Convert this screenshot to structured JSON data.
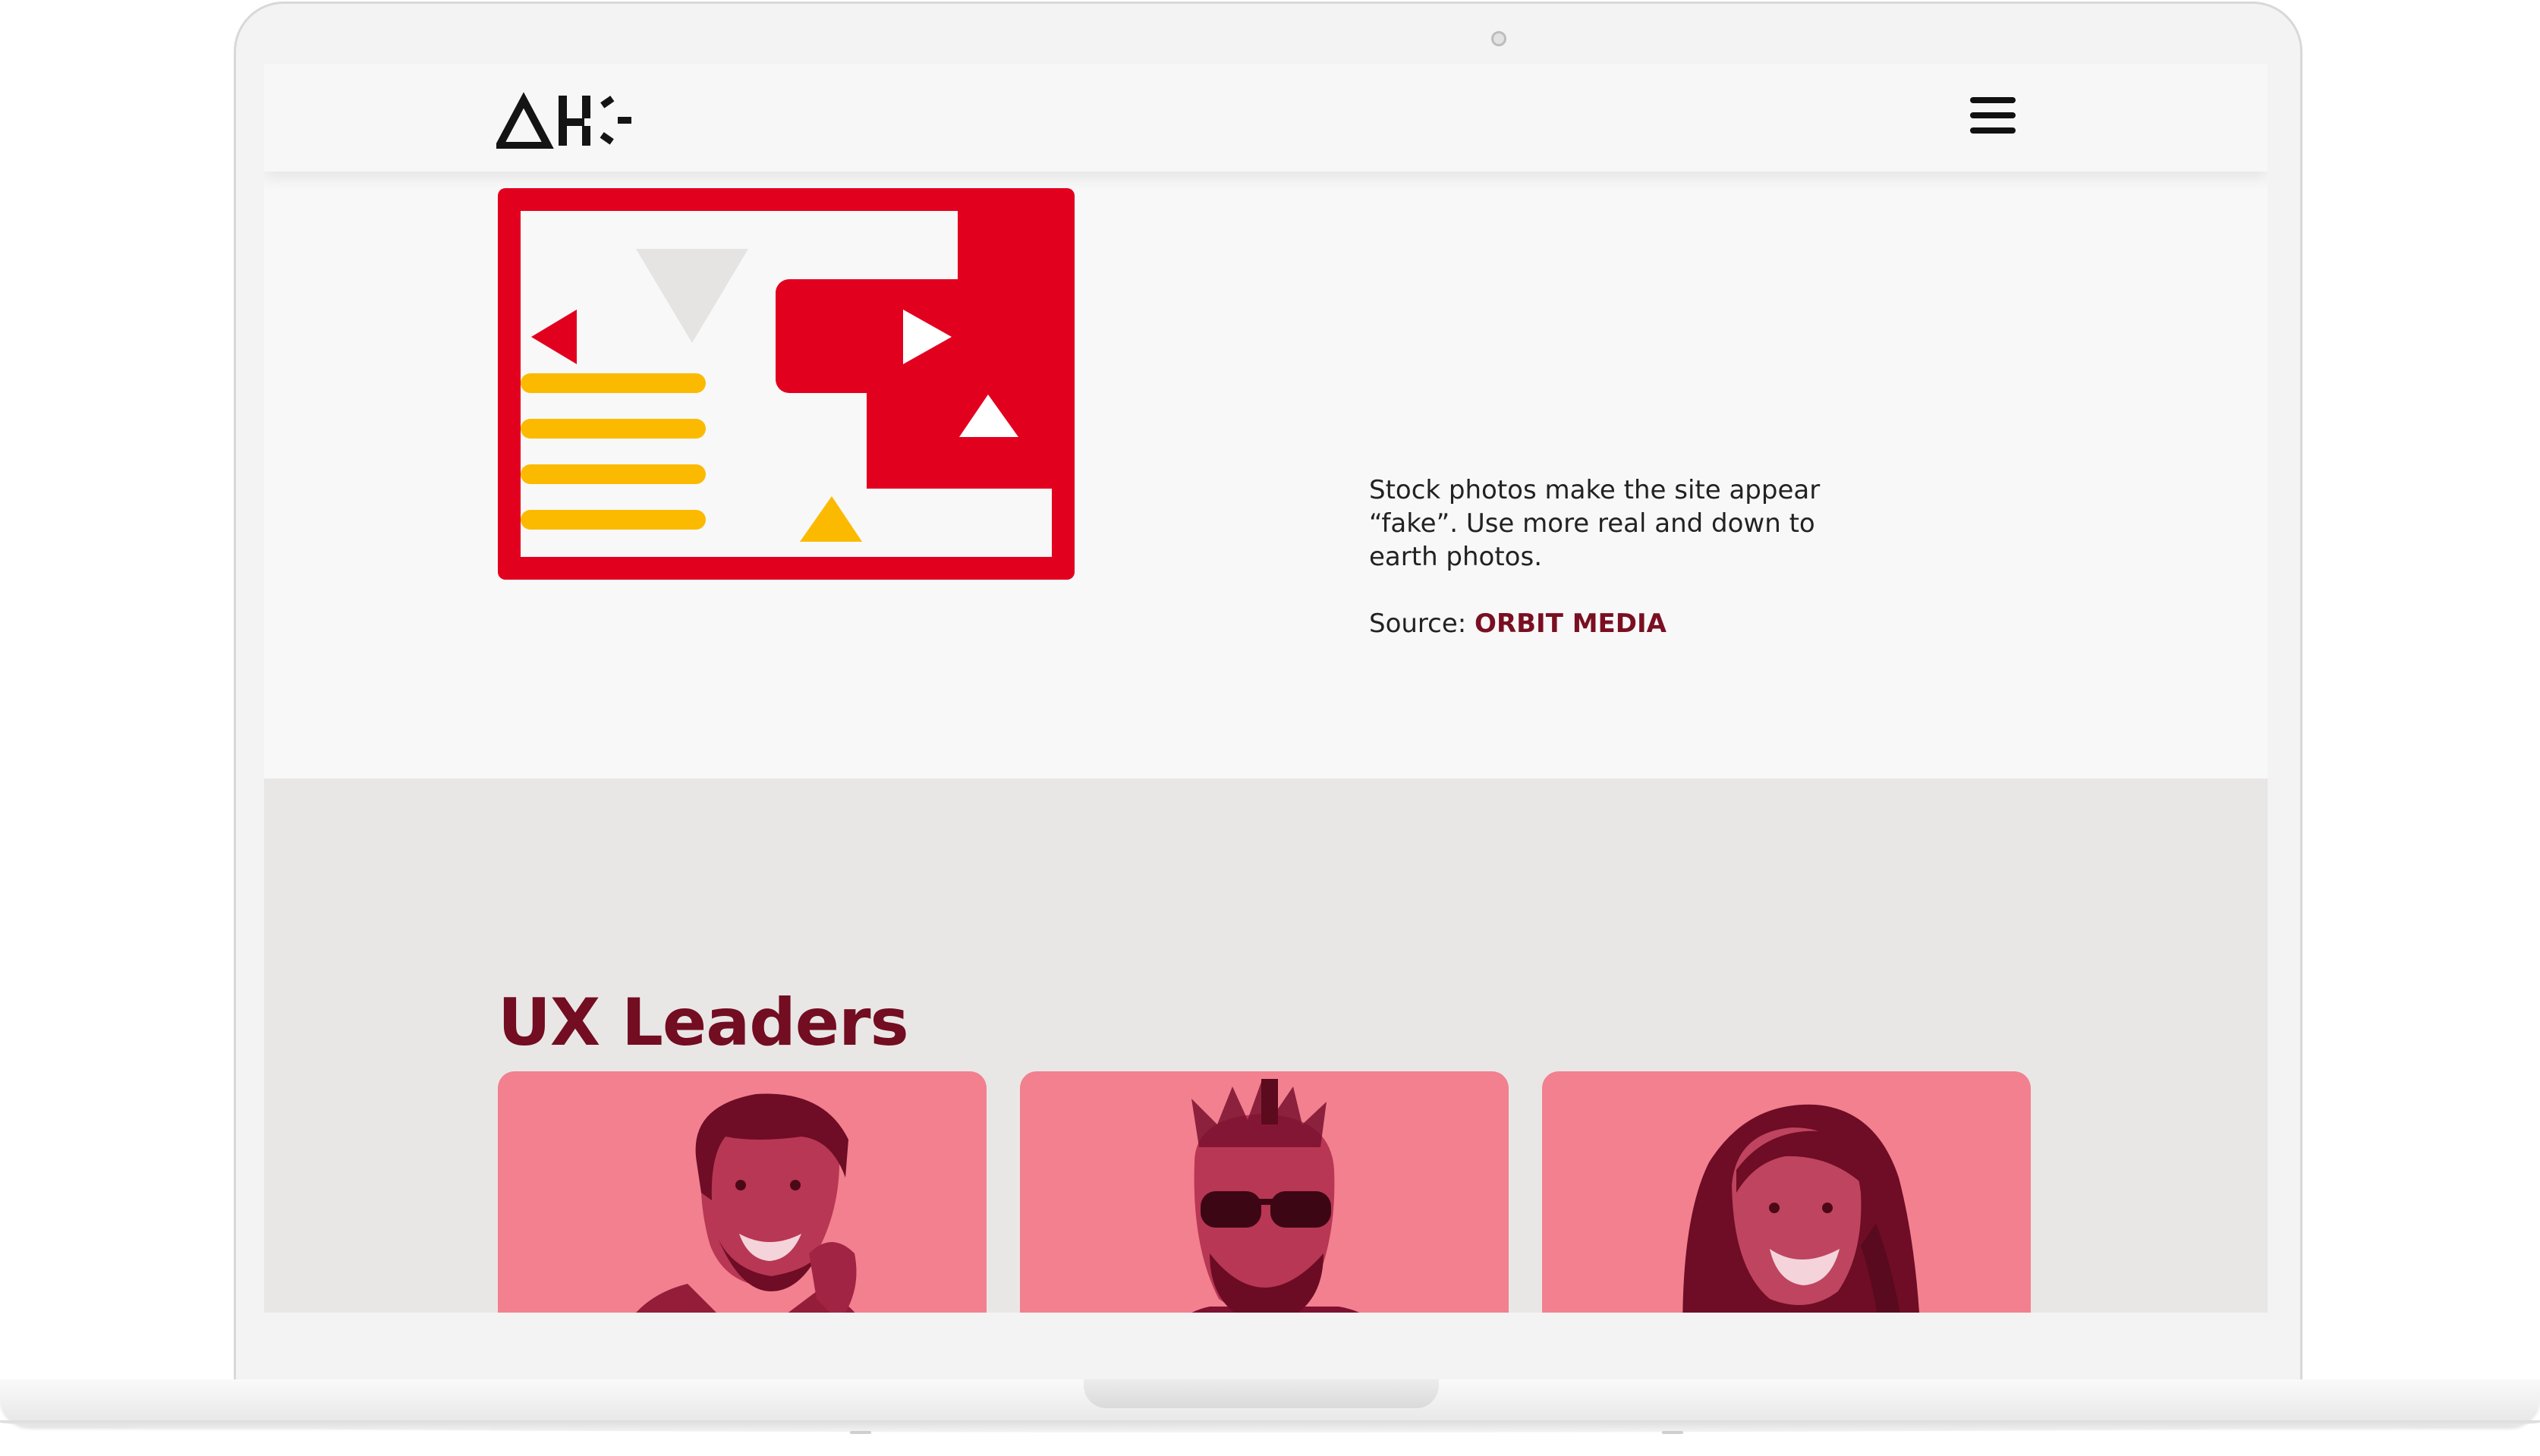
{
  "header": {
    "logo_alt": "AH logo",
    "menu_icon": "hamburger-menu-icon"
  },
  "hero": {
    "illustration_icon": "web-layout-illustration",
    "paragraph": "Stock photos make the site appear “fake”. Use more real and down to earth photos.",
    "source_label": "Source: ",
    "source_link_text": "ORBIT MEDIA"
  },
  "leaders": {
    "title": "UX Leaders",
    "cards": [
      {
        "portrait": "man-smiling-hand-on-chin-portrait"
      },
      {
        "portrait": "man-with-sunglasses-and-crown-portrait"
      },
      {
        "portrait": "woman-smiling-portrait"
      }
    ]
  },
  "colors": {
    "brand_red": "#E2001F",
    "accent_yellow": "#FBBA00",
    "title_maroon": "#730D21",
    "card_pink": "#F2808F",
    "portrait_ink": "#8A1230"
  }
}
